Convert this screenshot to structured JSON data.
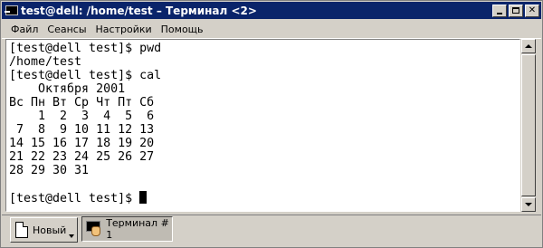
{
  "window": {
    "title": "test@dell: /home/test – Терминал <2>"
  },
  "menu": {
    "items": [
      "Файл",
      "Сеансы",
      "Настройки",
      "Помощь"
    ]
  },
  "terminal": {
    "lines": [
      "[test@dell test]$ pwd",
      "/home/test",
      "[test@dell test]$ cal",
      "    Октября 2001",
      "Вс Пн Вт Ср Чт Пт Сб",
      "    1  2  3  4  5  6",
      " 7  8  9 10 11 12 13",
      "14 15 16 17 18 19 20",
      "21 22 23 24 25 26 27",
      "28 29 30 31",
      "",
      "[test@dell test]$ "
    ]
  },
  "tabbar": {
    "new_label": "Новый",
    "tab_label": "Терминал # 1"
  },
  "colors": {
    "titlebar": "#0a246a",
    "chrome": "#d4d0c8"
  }
}
